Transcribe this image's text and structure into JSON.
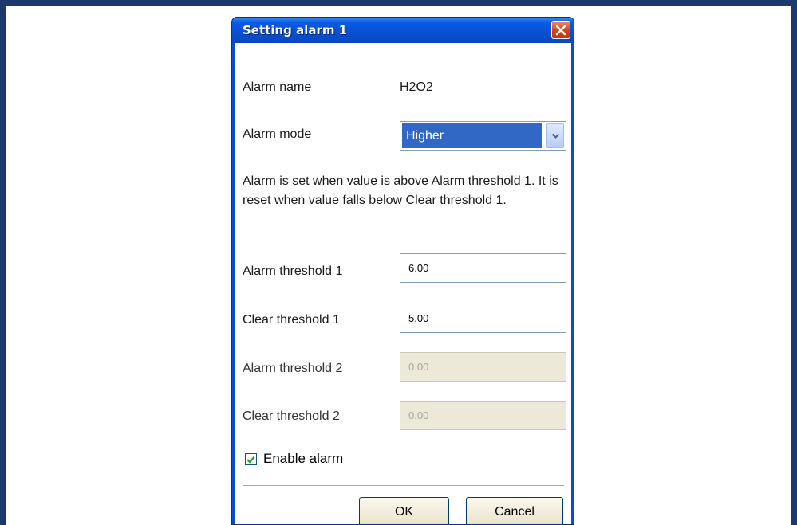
{
  "dialog": {
    "title": "Setting alarm 1",
    "close_icon": "close-icon"
  },
  "form": {
    "alarm_name_label": "Alarm name",
    "alarm_name_value": "H2O2",
    "alarm_mode_label": "Alarm mode",
    "alarm_mode_value": "Higher",
    "dropdown_icon": "chevron-down-icon",
    "description": "Alarm is set when value is above Alarm threshold 1. It is reset when value falls below Clear threshold 1.",
    "alarm_threshold_1_label": "Alarm threshold 1",
    "alarm_threshold_1_value": "6.00",
    "clear_threshold_1_label": "Clear threshold 1",
    "clear_threshold_1_value": "5.00",
    "alarm_threshold_2_label": "Alarm threshold 2",
    "alarm_threshold_2_value": "0.00",
    "clear_threshold_2_label": "Clear threshold 2",
    "clear_threshold_2_value": "0.00",
    "enable_alarm_label": "Enable alarm",
    "enable_alarm_checked": true
  },
  "buttons": {
    "ok_label": "OK",
    "cancel_label": "Cancel"
  },
  "colors": {
    "title_bar": "#0a4fd0",
    "selection": "#3168c6",
    "close_button": "#d6461e",
    "check_mark": "#21a121",
    "disabled_field": "#ece9d8"
  }
}
